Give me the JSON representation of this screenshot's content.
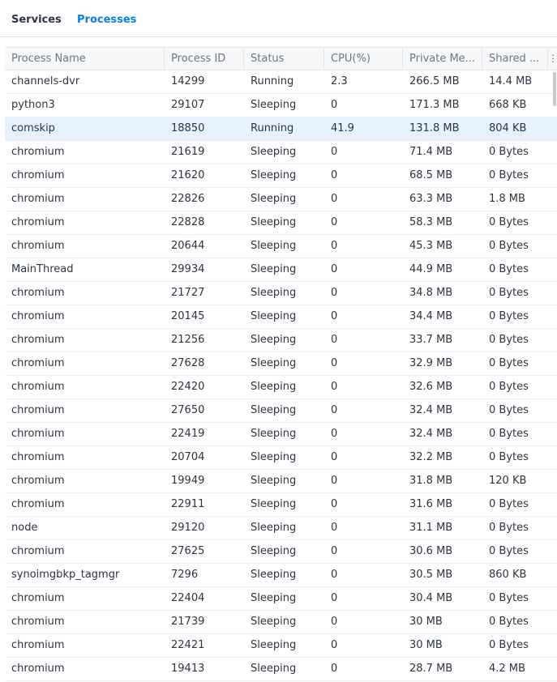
{
  "tabs": {
    "services": "Services",
    "processes": "Processes",
    "active_color": "#057feb"
  },
  "columns": [
    "Process Name",
    "Process ID",
    "Status",
    "CPU(%)",
    "Private Me...",
    "Shared ..."
  ],
  "column_menu_icon": "column-menu-icon",
  "selected_row": 2,
  "rows": [
    [
      "channels-dvr",
      "14299",
      "Running",
      "2.3",
      "266.5 MB",
      "14.4 MB"
    ],
    [
      "python3",
      "29107",
      "Sleeping",
      "0",
      "171.3 MB",
      "668 KB"
    ],
    [
      "comskip",
      "18850",
      "Running",
      "41.9",
      "131.8 MB",
      "804 KB"
    ],
    [
      "chromium",
      "21619",
      "Sleeping",
      "0",
      "71.4 MB",
      "0 Bytes"
    ],
    [
      "chromium",
      "21620",
      "Sleeping",
      "0",
      "68.5 MB",
      "0 Bytes"
    ],
    [
      "chromium",
      "22826",
      "Sleeping",
      "0",
      "63.3 MB",
      "1.8 MB"
    ],
    [
      "chromium",
      "22828",
      "Sleeping",
      "0",
      "58.3 MB",
      "0 Bytes"
    ],
    [
      "chromium",
      "20644",
      "Sleeping",
      "0",
      "45.3 MB",
      "0 Bytes"
    ],
    [
      "MainThread",
      "29934",
      "Sleeping",
      "0",
      "44.9 MB",
      "0 Bytes"
    ],
    [
      "chromium",
      "21727",
      "Sleeping",
      "0",
      "34.8 MB",
      "0 Bytes"
    ],
    [
      "chromium",
      "20145",
      "Sleeping",
      "0",
      "34.4 MB",
      "0 Bytes"
    ],
    [
      "chromium",
      "21256",
      "Sleeping",
      "0",
      "33.7 MB",
      "0 Bytes"
    ],
    [
      "chromium",
      "27628",
      "Sleeping",
      "0",
      "32.9 MB",
      "0 Bytes"
    ],
    [
      "chromium",
      "22420",
      "Sleeping",
      "0",
      "32.6 MB",
      "0 Bytes"
    ],
    [
      "chromium",
      "27650",
      "Sleeping",
      "0",
      "32.4 MB",
      "0 Bytes"
    ],
    [
      "chromium",
      "22419",
      "Sleeping",
      "0",
      "32.4 MB",
      "0 Bytes"
    ],
    [
      "chromium",
      "20704",
      "Sleeping",
      "0",
      "32.2 MB",
      "0 Bytes"
    ],
    [
      "chromium",
      "19949",
      "Sleeping",
      "0",
      "31.8 MB",
      "120 KB"
    ],
    [
      "chromium",
      "22911",
      "Sleeping",
      "0",
      "31.6 MB",
      "0 Bytes"
    ],
    [
      "node",
      "29120",
      "Sleeping",
      "0",
      "31.1 MB",
      "0 Bytes"
    ],
    [
      "chromium",
      "27625",
      "Sleeping",
      "0",
      "30.6 MB",
      "0 Bytes"
    ],
    [
      "synoimgbkp_tagmgr",
      "7296",
      "Sleeping",
      "0",
      "30.5 MB",
      "860 KB"
    ],
    [
      "chromium",
      "22404",
      "Sleeping",
      "0",
      "30.4 MB",
      "0 Bytes"
    ],
    [
      "chromium",
      "21739",
      "Sleeping",
      "0",
      "30 MB",
      "0 Bytes"
    ],
    [
      "chromium",
      "22421",
      "Sleeping",
      "0",
      "30 MB",
      "0 Bytes"
    ],
    [
      "chromium",
      "19413",
      "Sleeping",
      "0",
      "28.7 MB",
      "4.2 MB"
    ]
  ]
}
